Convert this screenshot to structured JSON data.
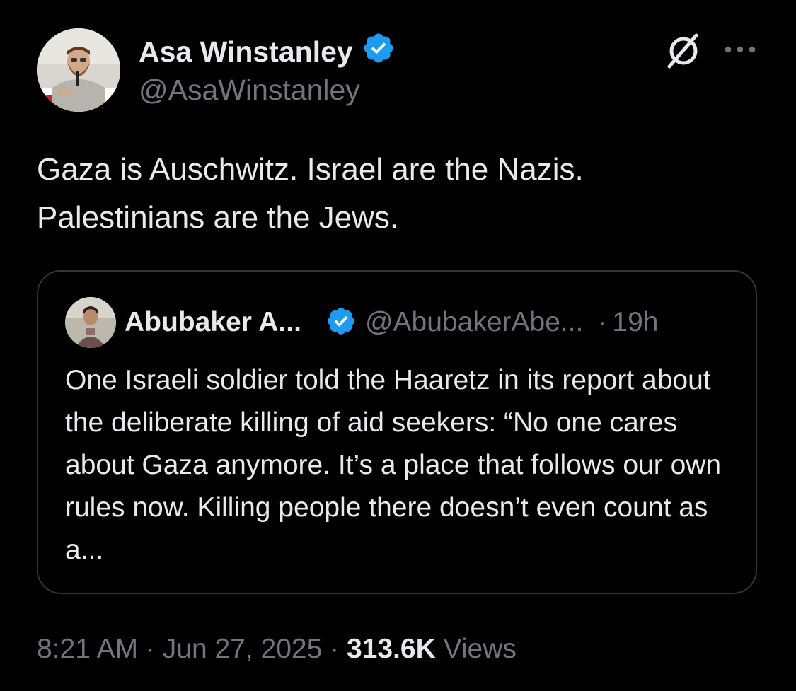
{
  "post": {
    "author": {
      "name": "Asa Winstanley",
      "handle": "@AsaWinstanley",
      "verified": true
    },
    "text": "Gaza is Auschwitz. Israel are the Nazis. Palestinians are the Jews.",
    "quoted": {
      "author_name": "Abubaker A...",
      "handle": "@AbubakerAbe...",
      "separator": "·",
      "time": "19h",
      "verified": true,
      "text": "One Israeli soldier told the Haaretz in its report about the deliberate killing of aid seekers: “No one cares about Gaza anymore. It’s a place that follows our own rules now. Killing people there doesn’t even count as a..."
    },
    "meta": {
      "time": "8:21 AM",
      "sep1": " · ",
      "date": "Jun 27, 2025",
      "sep2": " · ",
      "views_count": "313.6K",
      "views_label": " Views"
    }
  },
  "icons": {
    "verified": "verified-badge-icon",
    "grok": "grok-icon",
    "more": "more-options-icon"
  },
  "colors": {
    "background": "#000000",
    "primary_text": "#e7e9ea",
    "secondary_text": "#71767b",
    "verified_blue": "#1d9bf0",
    "card_border": "#333639"
  }
}
